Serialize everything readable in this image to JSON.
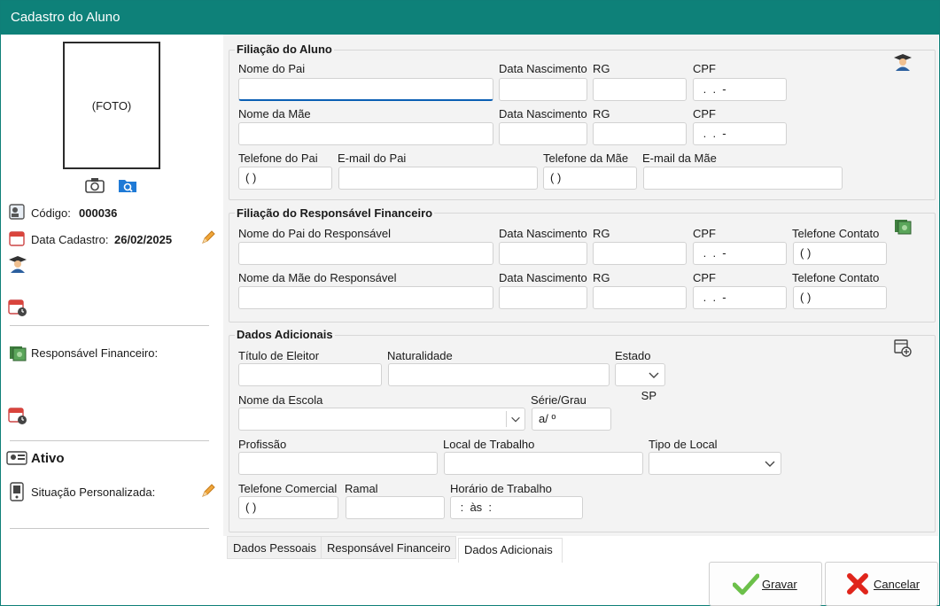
{
  "window": {
    "title": "Cadastro do Aluno"
  },
  "left": {
    "photo_placeholder": "(FOTO)",
    "codigo_label": "Código:",
    "codigo_value": "000036",
    "data_cadastro_label": "Data Cadastro:",
    "data_cadastro_value": "26/02/2025",
    "responsavel_label": "Responsável Financeiro:",
    "status": "Ativo",
    "situacao_label": "Situação Personalizada:"
  },
  "filiacao": {
    "title": "Filiação do Aluno",
    "nome_pai": "Nome do Pai",
    "data_nascimento": "Data Nascimento",
    "rg": "RG",
    "cpf": "CPF",
    "cpf_mask": " .  .  -",
    "nome_mae": "Nome da Mãe",
    "telefone_pai": "Telefone do Pai",
    "email_pai": "E-mail do Pai",
    "telefone_mae": "Telefone da Mãe",
    "email_mae": "E-mail da Mãe",
    "phone_mask": "( )"
  },
  "responsavel": {
    "title": "Filiação do Responsável Financeiro",
    "nome_pai_resp": "Nome do Pai do Responsável",
    "nome_mae_resp": "Nome da Mãe do Responsável",
    "data_nascimento": "Data Nascimento",
    "rg": "RG",
    "cpf": "CPF",
    "telefone_contato": "Telefone Contato",
    "cpf_mask": " .  .  -",
    "phone_mask": "( )"
  },
  "adicionais": {
    "title": "Dados Adicionais",
    "titulo_eleitor": "Título de Eleitor",
    "naturalidade": "Naturalidade",
    "estado": "Estado",
    "estado_value": "SP",
    "nome_escola": "Nome da Escola",
    "serie_grau": "Série/Grau",
    "serie_mask": "a/ º",
    "profissao": "Profissão",
    "local_trabalho": "Local de Trabalho",
    "tipo_local": "Tipo de Local",
    "telefone_comercial": "Telefone Comercial",
    "ramal": "Ramal",
    "horario_trabalho": "Horário de Trabalho",
    "phone_mask": "( )",
    "horario_mask": " :  às  :"
  },
  "tabs": [
    "Dados Pessoais",
    "Responsável Financeiro",
    "Dados Adicionais"
  ],
  "buttons": {
    "gravar": "Gravar",
    "cancelar": "Cancelar"
  },
  "colors": {
    "titlebar": "#0e8179",
    "focus": "#0a5fb4",
    "check": "#6cc04a",
    "cancel": "#e0251b"
  },
  "icons": [
    "camera-icon",
    "search-folder-icon",
    "id-card-icon",
    "calendar-icon",
    "pencil-icon",
    "graduate-icon",
    "calendar-clock-icon",
    "money-icon",
    "status-icon",
    "phone-icon",
    "add-form-icon",
    "check-icon",
    "cancel-x-icon"
  ]
}
